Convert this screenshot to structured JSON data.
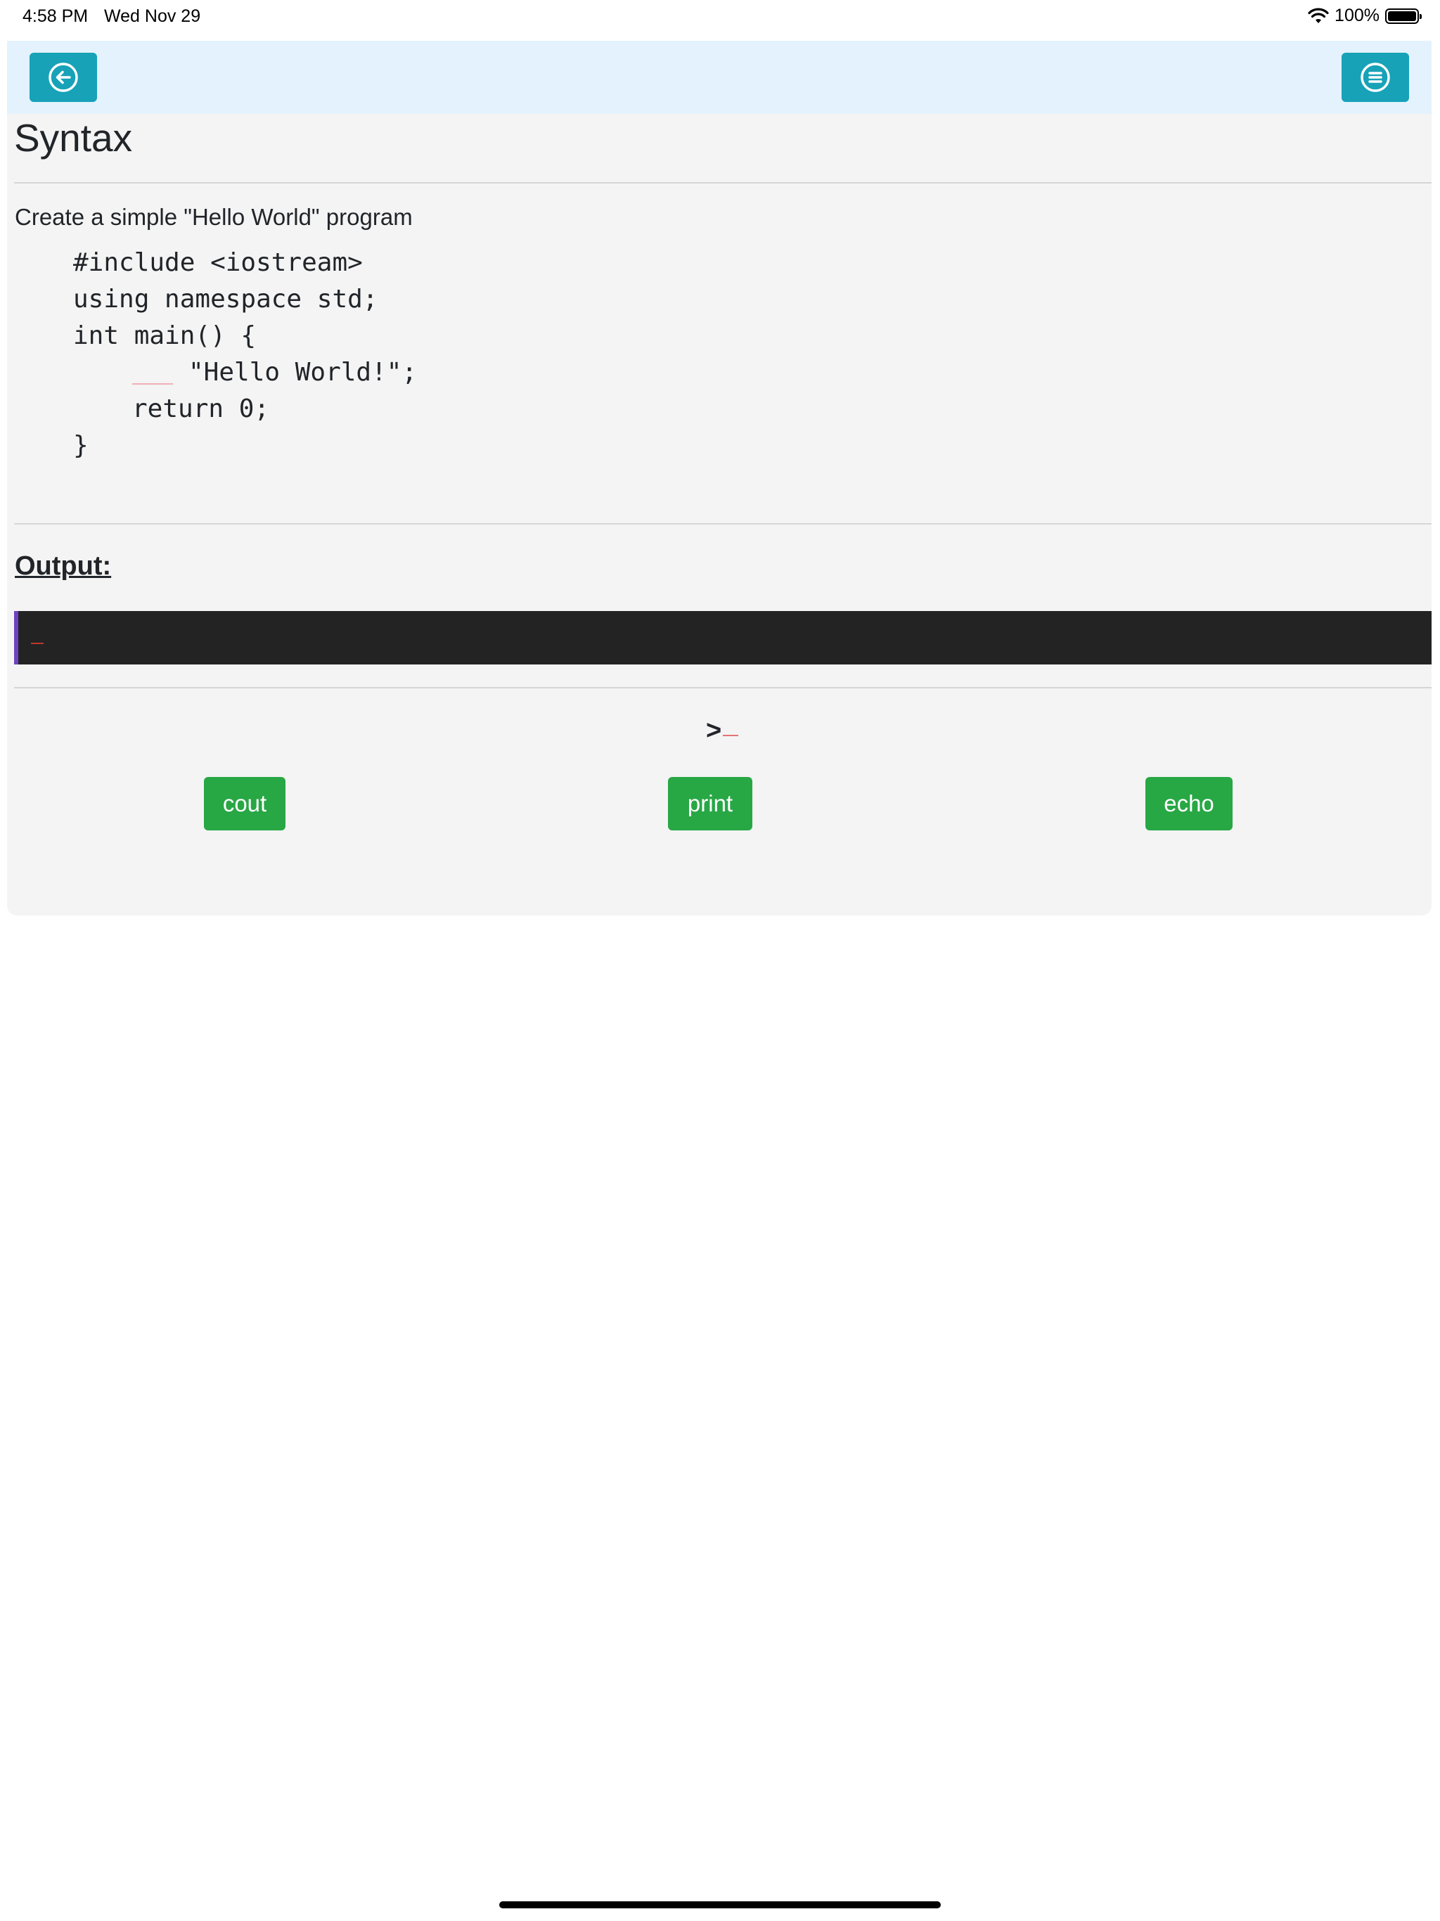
{
  "status": {
    "time": "4:58 PM",
    "date": "Wed Nov 29",
    "battery": "100%"
  },
  "header": {
    "back_icon": "arrow-left-circle-icon",
    "menu_icon": "list-circle-icon",
    "accent_color": "#17a2b8"
  },
  "lesson": {
    "title": "Syntax",
    "instruction": "Create a simple \"Hello World\" program",
    "code": {
      "line1": "#include <iostream>",
      "line2": "using namespace std;",
      "line3": "int main() {",
      "line4": "\"Hello World!\";",
      "line5": "return 0;",
      "line6": "}"
    },
    "output_label": "Output:",
    "prompt": ">"
  },
  "options": [
    {
      "label": "cout"
    },
    {
      "label": "print"
    },
    {
      "label": "echo"
    }
  ],
  "colors": {
    "option_button": "#28a745",
    "terminal_bg": "#232323",
    "terminal_accent": "#6f42c1"
  }
}
